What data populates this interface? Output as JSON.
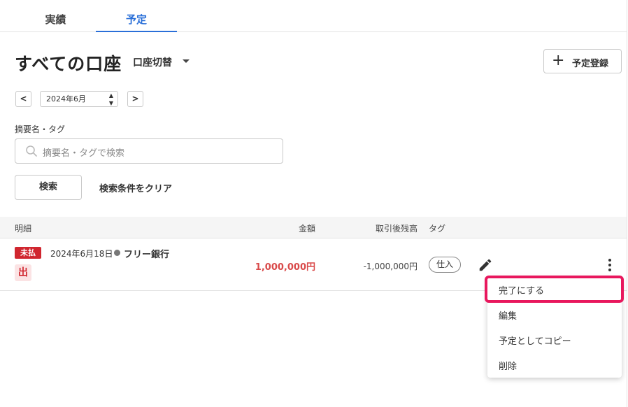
{
  "tabs": [
    {
      "label": "実績",
      "active": false
    },
    {
      "label": "予定",
      "active": true
    }
  ],
  "header": {
    "title": "すべての口座",
    "account_switch_label": "口座切替",
    "add_button_label": "予定登録"
  },
  "month_nav": {
    "prev_label": "<",
    "next_label": ">",
    "selected_month": "2024年6月"
  },
  "search": {
    "field_label": "摘要名・タグ",
    "placeholder": "摘要名・タグで検索",
    "search_button_label": "検索",
    "clear_label": "検索条件をクリア"
  },
  "table": {
    "headers": {
      "detail": "明細",
      "amount": "金額",
      "balance": "取引後残高",
      "tag": "タグ"
    },
    "rows": [
      {
        "status_badge": "未払",
        "direction_badge": "出",
        "date": "2024年6月18日",
        "bank": "フリー銀行",
        "amount": "1,000,000円",
        "balance": "-1,000,000円",
        "tag": "仕入"
      }
    ]
  },
  "context_menu": {
    "items": [
      "完了にする",
      "編集",
      "予定としてコピー",
      "削除"
    ],
    "highlighted_index": 0
  },
  "colors": {
    "accent_blue": "#2a6fd8",
    "badge_red": "#d0262f",
    "amount_red": "#d94a4a",
    "highlight_pink": "#e8175d"
  },
  "icons": {
    "search": "search-icon",
    "edit": "pencil-icon",
    "more": "vertical-ellipsis-icon",
    "add": "plus-icon",
    "dropdown": "caret-down-icon"
  }
}
